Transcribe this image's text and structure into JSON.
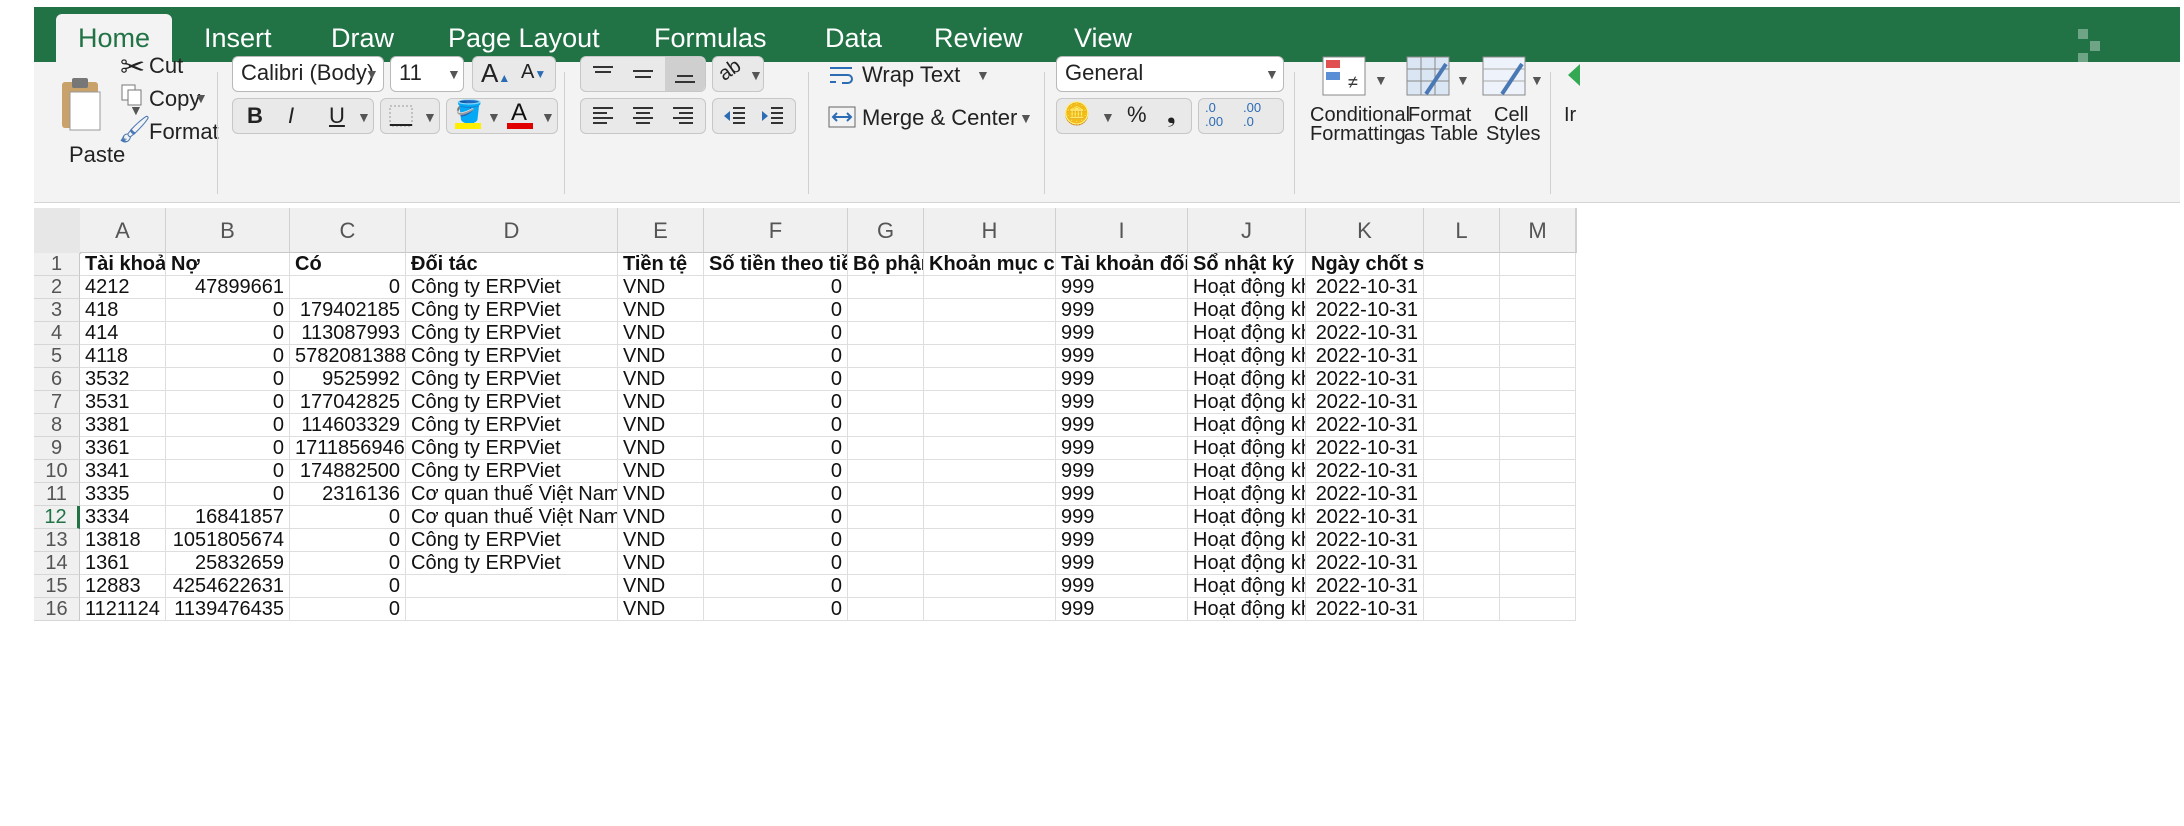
{
  "ribbon_tabs": [
    "Home",
    "Insert",
    "Draw",
    "Page Layout",
    "Formulas",
    "Data",
    "Review",
    "View"
  ],
  "clipboard": {
    "paste": "Paste",
    "cut": "Cut",
    "copy": "Copy",
    "format": "Format"
  },
  "font": {
    "family": "Calibri (Body)",
    "size": "11",
    "bold": "B",
    "italic": "I",
    "underline": "U",
    "grow": "A",
    "shrink": "A",
    "color_letter": "A"
  },
  "alignment": {
    "wrap_text": "Wrap Text",
    "merge_center": "Merge & Center",
    "decrease": ".0\n.00",
    "increase": ".00\n.0"
  },
  "number": {
    "format": "General",
    "percent": "%",
    "comma": "❟",
    "decrease_decimal": "←.0 .00",
    "increase_decimal": ".00 →.0"
  },
  "styles": {
    "conditional_l1": "Conditional",
    "conditional_l2": "Formatting",
    "table_l1": "Format",
    "table_l2": "as Table",
    "cell_l1": "Cell",
    "cell_l2": "Styles",
    "insert_partial": "Ir"
  },
  "columns": [
    "A",
    "B",
    "C",
    "D",
    "E",
    "F",
    "G",
    "H",
    "I",
    "J",
    "K",
    "L",
    "M"
  ],
  "row_numbers": [
    "1",
    "2",
    "3",
    "4",
    "5",
    "6",
    "7",
    "8",
    "9",
    "10",
    "11",
    "12",
    "13",
    "14",
    "15",
    "16"
  ],
  "selected_row": "12",
  "header_row": [
    "Tài khoản",
    "Nợ",
    "Có",
    "Đối tác",
    "Tiền tệ",
    "Số tiền theo tiền tệ",
    "Bộ phận",
    "Khoản mục chi phí",
    "Tài khoản đối ứng",
    "Sổ nhật ký",
    "Ngày chốt số dư"
  ],
  "rows": [
    [
      "4212",
      "47899661",
      "0",
      "Công ty ERPViet",
      "VND",
      "0",
      "",
      "",
      "999",
      "Hoạt động khác",
      "2022-10-31"
    ],
    [
      "418",
      "0",
      "179402185",
      "Công ty ERPViet",
      "VND",
      "0",
      "",
      "",
      "999",
      "Hoạt động khác",
      "2022-10-31"
    ],
    [
      "414",
      "0",
      "113087993",
      "Công ty ERPViet",
      "VND",
      "0",
      "",
      "",
      "999",
      "Hoạt động khác",
      "2022-10-31"
    ],
    [
      "4118",
      "0",
      "5782081388",
      "Công ty ERPViet",
      "VND",
      "0",
      "",
      "",
      "999",
      "Hoạt động khác",
      "2022-10-31"
    ],
    [
      "3532",
      "0",
      "9525992",
      "Công ty ERPViet",
      "VND",
      "0",
      "",
      "",
      "999",
      "Hoạt động khác",
      "2022-10-31"
    ],
    [
      "3531",
      "0",
      "177042825",
      "Công ty ERPViet",
      "VND",
      "0",
      "",
      "",
      "999",
      "Hoạt động khác",
      "2022-10-31"
    ],
    [
      "3381",
      "0",
      "114603329",
      "Công ty ERPViet",
      "VND",
      "0",
      "",
      "",
      "999",
      "Hoạt động khác",
      "2022-10-31"
    ],
    [
      "3361",
      "0",
      "1711856946",
      "Công ty ERPViet",
      "VND",
      "0",
      "",
      "",
      "999",
      "Hoạt động khác",
      "2022-10-31"
    ],
    [
      "3341",
      "0",
      "174882500",
      "Công ty ERPViet",
      "VND",
      "0",
      "",
      "",
      "999",
      "Hoạt động khác",
      "2022-10-31"
    ],
    [
      "3335",
      "0",
      "2316136",
      "Cơ quan thuế Việt Nam",
      "VND",
      "0",
      "",
      "",
      "999",
      "Hoạt động khác",
      "2022-10-31"
    ],
    [
      "3334",
      "16841857",
      "0",
      "Cơ quan thuế Việt Nam",
      "VND",
      "0",
      "",
      "",
      "999",
      "Hoạt động khác",
      "2022-10-31"
    ],
    [
      "13818",
      "1051805674",
      "0",
      "Công ty ERPViet",
      "VND",
      "0",
      "",
      "",
      "999",
      "Hoạt động khác",
      "2022-10-31"
    ],
    [
      "1361",
      "25832659",
      "0",
      "Công ty ERPViet",
      "VND",
      "0",
      "",
      "",
      "999",
      "Hoạt động khác",
      "2022-10-31"
    ],
    [
      "12883",
      "4254622631",
      "0",
      "",
      "VND",
      "0",
      "",
      "",
      "999",
      "Hoạt động khác",
      "2022-10-31"
    ],
    [
      "1121124",
      "1139476435",
      "0",
      "",
      "VND",
      "0",
      "",
      "",
      "999",
      "Hoạt động khác",
      "2022-10-31"
    ]
  ],
  "colors": {
    "excel_green": "#217346",
    "font_color_bar": "#e00000",
    "highlight_bar": "#ffee00"
  }
}
